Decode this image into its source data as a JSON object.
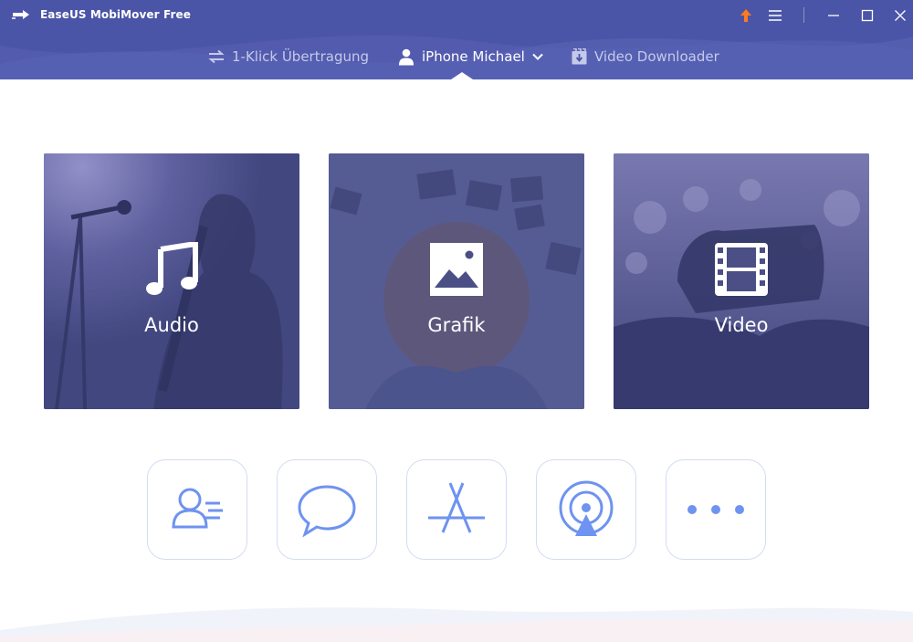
{
  "window": {
    "title": "EaseUS MobiMover Free",
    "accent": "#4a54a6",
    "update_color": "#ff7a1a"
  },
  "nav": {
    "items": [
      {
        "label": "1-Klick Übertragung",
        "icon": "transfer-icon"
      },
      {
        "label": "iPhone Michael",
        "icon": "user-icon",
        "active": true
      },
      {
        "label": "Video Downloader",
        "icon": "video-download-icon"
      }
    ]
  },
  "categories": [
    {
      "label": "Audio",
      "icon": "music-note-icon"
    },
    {
      "label": "Grafik",
      "icon": "image-icon"
    },
    {
      "label": "Video",
      "icon": "film-icon"
    }
  ],
  "tools": [
    {
      "icon": "contacts-icon"
    },
    {
      "icon": "message-bubble-icon"
    },
    {
      "icon": "app-store-icon"
    },
    {
      "icon": "podcast-icon"
    },
    {
      "icon": "more-dots-icon"
    }
  ]
}
